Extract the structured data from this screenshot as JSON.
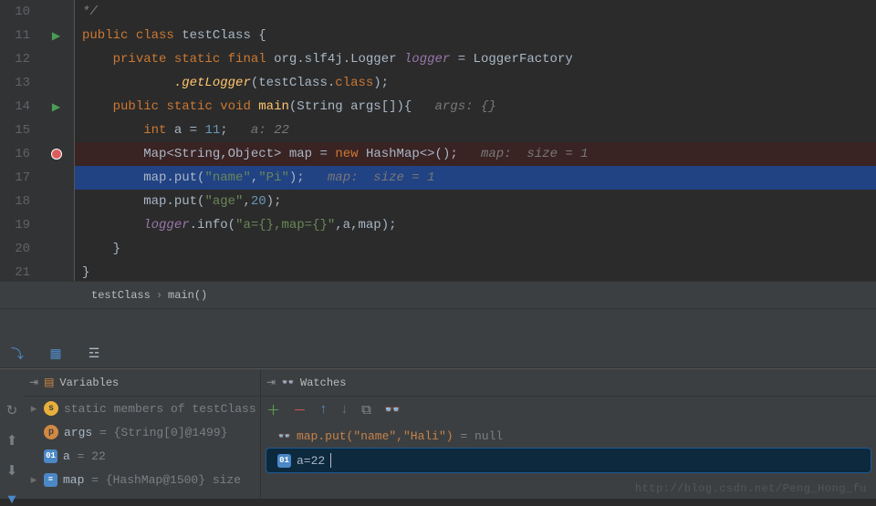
{
  "lines": {
    "n10": "10",
    "n11": "11",
    "n12": "12",
    "n13": "13",
    "n14": "14",
    "n15": "15",
    "n16": "16",
    "n17": "17",
    "n18": "18",
    "n19": "19",
    "n20": "20",
    "n21": "21"
  },
  "code": {
    "l10": "*/",
    "public": "public",
    "class": "class",
    "clsName": "testClass",
    "open": "{",
    "close": "}",
    "private": "private",
    "static": "static",
    "final": "final",
    "logType": "org.slf4j.Logger",
    "logger": "logger",
    "eq": "=",
    "factory": "LoggerFactory",
    "getLogger": ".getLogger",
    "getArg": "(testClass.",
    "classKw": "class",
    "paren": ");",
    "void": "void",
    "main": "main",
    "mainArgs": "(String args[]){   ",
    "argsHint": "args: {}",
    "int": "int",
    "a": "a",
    "eq2": " = ",
    "eleven": "11",
    "semi": ";   ",
    "aHint": "a: 22",
    "map": "Map",
    "gen": "<String,Object>",
    "mapn": "map",
    "new": "new",
    "hashmap": "HashMap",
    "diamond": "<>();   ",
    "mapHint": "map:  size = 1",
    "put1a": "map.put(",
    "nameStr": "\"name\"",
    "comma": ",",
    "piStr": "\"Pi\"",
    "put1b": ");   ",
    "mapHint2": "map:  size = 1",
    "put2a": "map.put(",
    "ageStr": "\"age\"",
    "twenty": "20",
    "put2b": ");",
    "loggerf": "logger",
    "info": ".info(",
    "fmt": "\"a={},map={}\"",
    "args2": ",a,map);"
  },
  "breadcrumb": {
    "a": "testClass",
    "b": "main()"
  },
  "panels": {
    "vars": "Variables",
    "watches": "Watches"
  },
  "vars": {
    "static": "static members of testClass",
    "args": "args",
    "argsVal": " = {String[0]@1499}",
    "aName": "a",
    "aVal": " = 22",
    "mapName": "map",
    "mapVal": " = {HashMap@1500}  size"
  },
  "watches": {
    "expr1": "map.put(\"name\",\"Hali\")",
    "res1": " = null",
    "expr2": "a=22"
  },
  "watermark": "http://blog.csdn.net/Peng_Hong_fu"
}
